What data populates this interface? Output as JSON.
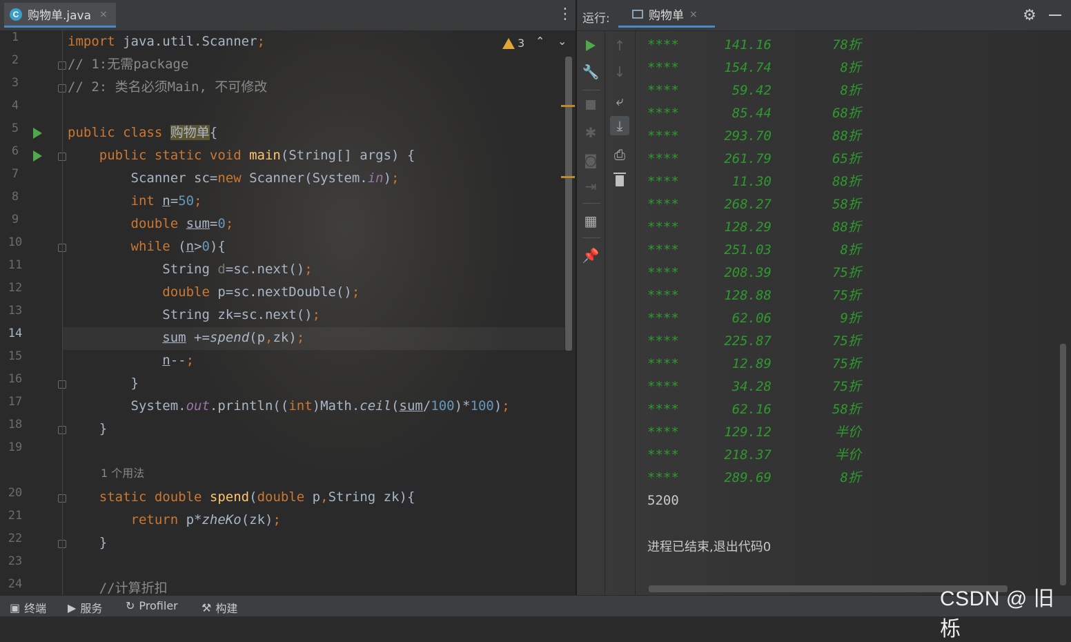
{
  "editor": {
    "tab_label": "购物单.java",
    "tab_close": "×",
    "more_icon": "⋮",
    "warning_count": "3",
    "line_numbers": [
      "1",
      "2",
      "3",
      "4",
      "5",
      "6",
      "7",
      "8",
      "9",
      "10",
      "11",
      "12",
      "13",
      "14",
      "15",
      "16",
      "17",
      "18",
      "19",
      "20",
      "21",
      "22",
      "23",
      "24"
    ],
    "current_line": "14",
    "usage_hint": "1 个用法"
  },
  "run": {
    "title": "运行:",
    "tab_label": "购物单",
    "tab_close": "×",
    "output_rows": [
      {
        "stars": "****",
        "price": "141.16",
        "discount": "78折"
      },
      {
        "stars": "****",
        "price": "154.74",
        "discount": "8折"
      },
      {
        "stars": "****",
        "price": "59.42",
        "discount": "8折"
      },
      {
        "stars": "****",
        "price": "85.44",
        "discount": "68折"
      },
      {
        "stars": "****",
        "price": "293.70",
        "discount": "88折"
      },
      {
        "stars": "****",
        "price": "261.79",
        "discount": "65折"
      },
      {
        "stars": "****",
        "price": "11.30",
        "discount": "88折"
      },
      {
        "stars": "****",
        "price": "268.27",
        "discount": "58折"
      },
      {
        "stars": "****",
        "price": "128.29",
        "discount": "88折"
      },
      {
        "stars": "****",
        "price": "251.03",
        "discount": "8折"
      },
      {
        "stars": "****",
        "price": "208.39",
        "discount": "75折"
      },
      {
        "stars": "****",
        "price": "128.88",
        "discount": "75折"
      },
      {
        "stars": "****",
        "price": "62.06",
        "discount": "9折"
      },
      {
        "stars": "****",
        "price": "225.87",
        "discount": "75折"
      },
      {
        "stars": "****",
        "price": "12.89",
        "discount": "75折"
      },
      {
        "stars": "****",
        "price": "34.28",
        "discount": "75折"
      },
      {
        "stars": "****",
        "price": "62.16",
        "discount": "58折"
      },
      {
        "stars": "****",
        "price": "129.12",
        "discount": "半价"
      },
      {
        "stars": "****",
        "price": "218.37",
        "discount": "半价"
      },
      {
        "stars": "****",
        "price": "289.69",
        "discount": "8折"
      }
    ],
    "result": "5200",
    "exit_message": "进程已结束,退出代码0"
  },
  "bottom_bar": {
    "terminal": "终端",
    "services": "服务",
    "profiler": "Profiler",
    "build": "构建"
  },
  "watermark": "CSDN @ 旧栎",
  "colors": {
    "keyword": "#cc7832",
    "comment": "#8a8a8a",
    "number": "#6897bb",
    "function": "#ffc66d",
    "output_green": "#2e9a2e",
    "accent": "#4a88c7"
  }
}
